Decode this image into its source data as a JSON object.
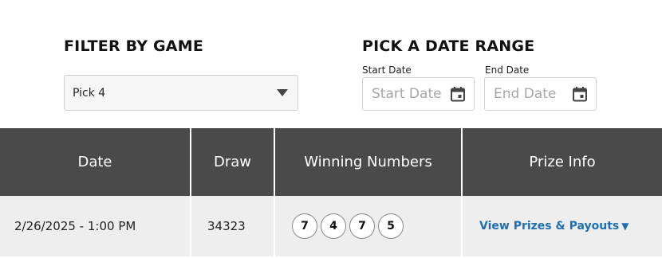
{
  "filter": {
    "heading": "FILTER BY GAME",
    "selected": "Pick 4",
    "icon": "chevron-down-icon"
  },
  "date_range": {
    "heading": "PICK A DATE RANGE",
    "start_label": "Start Date",
    "start_placeholder": "Start Date",
    "end_label": "End Date",
    "end_placeholder": "End Date",
    "icon": "calendar-icon"
  },
  "table": {
    "headers": [
      "Date",
      "Draw",
      "Winning Numbers",
      "Prize Info"
    ],
    "rows": [
      {
        "date": "2/26/2025 - 1:00 PM",
        "draw": "34323",
        "numbers": [
          "7",
          "4",
          "7",
          "5"
        ],
        "prize_link": "View Prizes & Payouts",
        "prize_arrow": "▼"
      }
    ]
  },
  "colors": {
    "header_bg": "#4a4a4a",
    "row_bg": "#eeeeee",
    "link": "#1f6fb5"
  }
}
